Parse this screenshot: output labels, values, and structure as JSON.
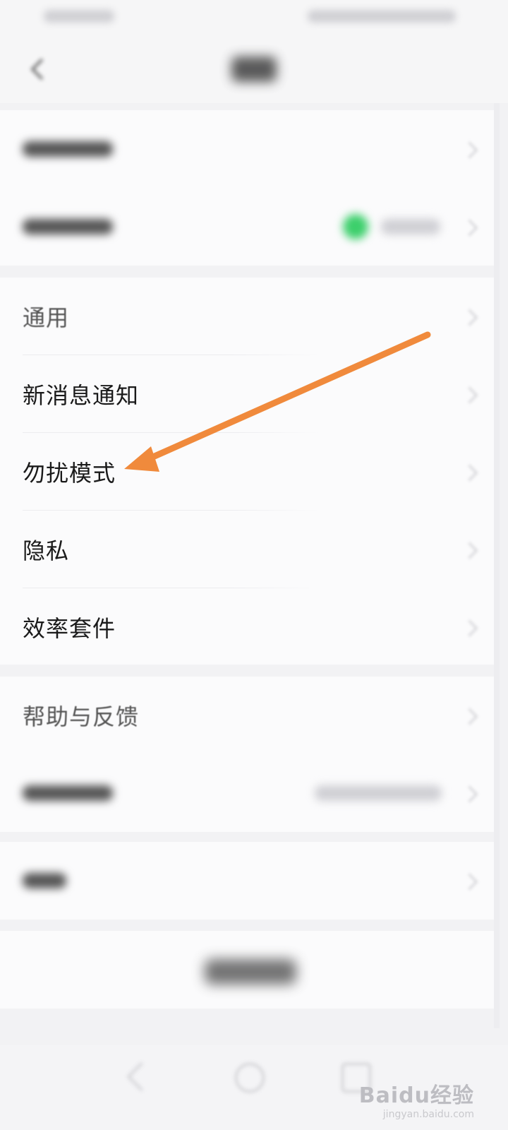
{
  "settings": {
    "general": "通用",
    "new_message_notification": "新消息通知",
    "do_not_disturb": "勿扰模式",
    "privacy": "隐私",
    "efficiency_suite": "效率套件",
    "help_feedback": "帮助与反馈"
  },
  "annotation": {
    "arrow_color": "#F08A3C"
  },
  "watermark": {
    "brand": "Baidu经验",
    "url": "jingyan.baidu.com"
  },
  "icons": {
    "back": "chevron-left-icon",
    "row_arrow": "chevron-right-icon",
    "status": "status-dot-icon",
    "nav_back": "nav-back-icon",
    "nav_home": "nav-home-icon",
    "nav_recent": "nav-recent-icon"
  },
  "colors": {
    "status_green": "#3CCF6B",
    "background": "#F2F2F4",
    "card": "#FBFBFC"
  }
}
